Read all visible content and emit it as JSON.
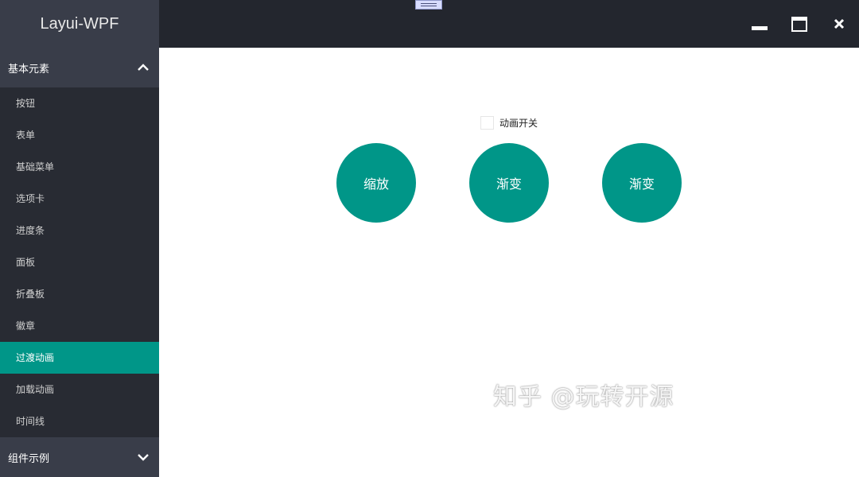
{
  "app": {
    "title": "Layui-WPF"
  },
  "sidebar": {
    "group_expanded": "基本元素",
    "items": [
      {
        "label": "按钮"
      },
      {
        "label": "表单"
      },
      {
        "label": "基础菜单"
      },
      {
        "label": "选项卡"
      },
      {
        "label": "进度条"
      },
      {
        "label": "面板"
      },
      {
        "label": "折叠板"
      },
      {
        "label": "徽章"
      },
      {
        "label": "过渡动画",
        "active": true
      },
      {
        "label": "加载动画"
      },
      {
        "label": "时间线"
      }
    ],
    "group_collapsed": "组件示例"
  },
  "main": {
    "animation_toggle": {
      "label": "动画开关",
      "checked": false
    },
    "circles": [
      {
        "label": "缩放"
      },
      {
        "label": "渐变"
      },
      {
        "label": "渐变"
      }
    ]
  },
  "watermark": "知乎 @玩转开源",
  "colors": {
    "accent": "#009688",
    "sidebar_bg": "#282b33",
    "header_bg": "#393d49",
    "titlebar_bg": "#23262e"
  },
  "icons": {
    "expand": "chevron-up-icon",
    "collapse": "chevron-down-icon",
    "minimize": "minimize-icon",
    "maximize": "maximize-icon",
    "close": "close-icon"
  }
}
